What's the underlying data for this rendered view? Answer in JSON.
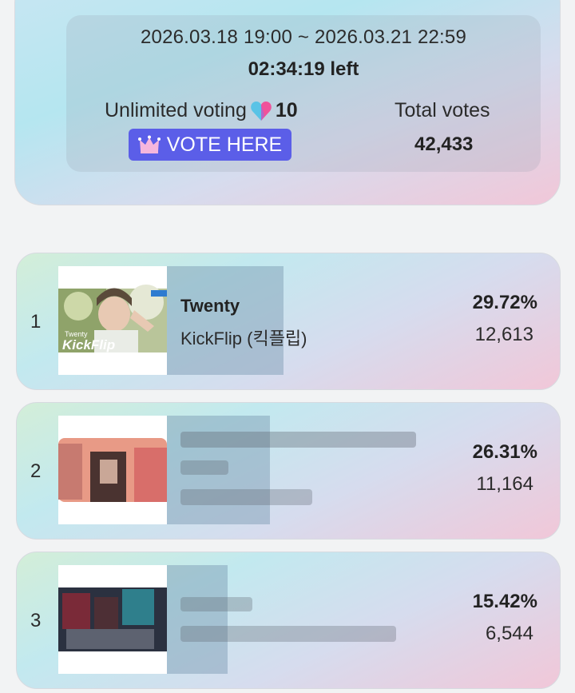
{
  "event": {
    "period": "2026.03.18 19:00 ~ 2026.03.21 22:59",
    "time_left": "02:34:19 left",
    "unlimited_label": "Unlimited voting",
    "vote_cost": "10",
    "vote_button_label": "VOTE HERE",
    "total_votes_label": "Total votes",
    "total_votes_value": "42,433"
  },
  "rankings": [
    {
      "rank": "1",
      "title": "Twenty",
      "artist": "KickFlip (킥플립)",
      "percent": "29.72%",
      "votes": "12,613",
      "share": 0.2972,
      "thumb_caption_small": "Twenty",
      "thumb_caption_big": "KickFlip"
    },
    {
      "rank": "2",
      "title": "",
      "artist": "",
      "percent": "26.31%",
      "votes": "11,164",
      "share": 0.2631
    },
    {
      "rank": "3",
      "title": "",
      "artist": "",
      "percent": "15.42%",
      "votes": "6,544",
      "share": 0.1542
    }
  ],
  "colors": {
    "vote_button": "#5b5ee8",
    "heart_left": "#59c3e6",
    "heart_right": "#f0529a"
  },
  "icons": {
    "heart": "half-blue-half-pink-heart-icon",
    "crown": "crown-icon"
  }
}
